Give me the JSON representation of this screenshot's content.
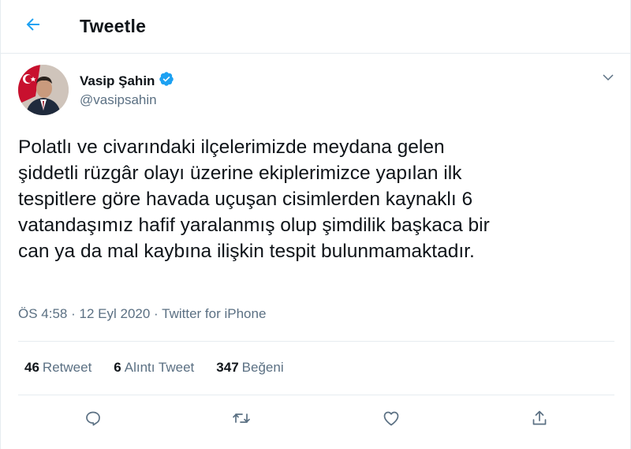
{
  "header": {
    "title": "Tweetle",
    "back_icon": "arrow-left-icon"
  },
  "colors": {
    "accent": "#1da1f2",
    "text": "#0f1419",
    "secondary": "#5b7083",
    "divider": "#e6ecf0"
  },
  "tweet": {
    "author_name": "Vasip Şahin",
    "verified": true,
    "author_handle": "@vasipsahin",
    "text": "Polatlı ve civarındaki ilçelerimizde meydana gelen\nşiddetli rüzgâr olayı üzerine ekiplerimizce yapılan  ilk\ntespitlere göre havada uçuşan cisimlerden kaynaklı 6\nvatandaşımız  hafif yaralanmış olup şimdilik başkaca bir\ncan ya da mal kaybına ilişkin tespit bulunmamaktadır.",
    "time": "ÖS 4:58",
    "date": "12 Eyl 2020",
    "separator": "·",
    "source": "Twitter for iPhone"
  },
  "stats": [
    {
      "count": "46",
      "label": "Retweet"
    },
    {
      "count": "6",
      "label": "Alıntı Tweet"
    },
    {
      "count": "347",
      "label": "Beğeni"
    }
  ],
  "actions": [
    "reply-icon",
    "retweet-icon",
    "like-icon",
    "share-icon"
  ]
}
